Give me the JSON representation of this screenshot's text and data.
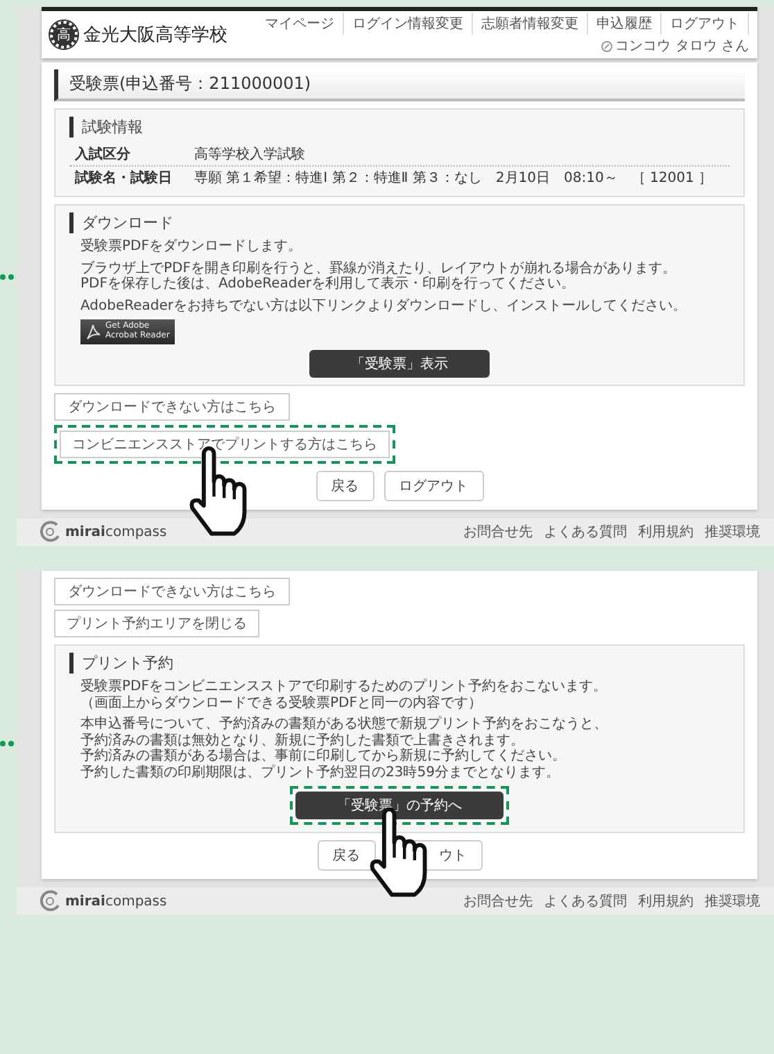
{
  "screens": [
    {
      "header": {
        "emblem": "高",
        "school": "金光大阪高等学校",
        "nav": [
          "マイページ",
          "ログイン情報変更",
          "志願者情報変更",
          "申込履歴",
          "ログアウト"
        ],
        "user": "コンコウ タロウ さん"
      },
      "page_title": "受験票(申込番号：211000001)",
      "blocks": [
        {
          "kind": "info",
          "heading": "試験情報",
          "rows": [
            {
              "label": "入試区分",
              "value": "高等学校入学試験"
            },
            {
              "label": "試験名・試験日",
              "value": "専願 第１希望：特進Ⅰ 第２：特進Ⅱ 第３：なし　2月10日　08:10～　［ 12001 ］"
            }
          ]
        },
        {
          "kind": "download",
          "heading": "ダウンロード",
          "paragraphs": [
            [
              "受験票PDFをダウンロードします。"
            ],
            [
              "ブラウザ上でPDFを開き印刷を行うと、罫線が消えたり、レイアウトが崩れる場合があります。",
              "PDFを保存した後は、AdobeReaderを利用して表示・印刷を行ってください。"
            ],
            [
              "AdobeReaderをお持ちでない方は以下リンクよりダウンロードし、インストールしてください。"
            ]
          ],
          "badge": [
            "Get Adobe",
            "Acrobat Reader"
          ],
          "button": {
            "label": "「受験票」表示",
            "highlighted": false
          }
        },
        {
          "kind": "links",
          "links": [
            {
              "label": "ダウンロードできない方はこちら",
              "highlighted": false
            },
            {
              "label": "コンビニエンスストアでプリントする方はこちら",
              "highlighted": true
            }
          ]
        },
        {
          "kind": "actions",
          "actions": [
            {
              "label": "戻る"
            },
            {
              "label": "ログアウト"
            }
          ]
        }
      ],
      "footer": {
        "logo": "**mirai**compass",
        "links": [
          "お問合せ先",
          "よくある質問",
          "利用規約",
          "推奨環境"
        ]
      }
    },
    {
      "blocks": [
        {
          "kind": "links",
          "links": [
            {
              "label": "ダウンロードできない方はこちら",
              "highlighted": false
            },
            {
              "label": "プリント予約エリアを閉じる",
              "highlighted": false
            }
          ]
        },
        {
          "kind": "print",
          "heading": "プリント予約",
          "paragraphs": [
            [
              "受験票PDFをコンビニエンスストアで印刷するためのプリント予約をおこないます。",
              "（画面上からダウンロードできる受験票PDFと同一の内容です）"
            ],
            [
              "本申込番号について、予約済みの書類がある状態で新規プリント予約をおこなうと、",
              "予約済みの書類は無効となり、新規に予約した書類で上書きされます。",
              "予約済みの書類がある場合は、事前に印刷してから新規に予約してください。",
              "予約した書類の印刷期限は、プリント予約翌日の23時59分までとなります。"
            ]
          ],
          "button": {
            "label": "「受験票」の予約へ",
            "highlighted": true
          }
        },
        {
          "kind": "actions",
          "actions": [
            {
              "label": "戻る",
              "covered": false
            },
            {
              "label": "ウト",
              "covered": true
            }
          ]
        }
      ],
      "footer": {
        "logo": "**mirai**compass",
        "links": [
          "お問合せ先",
          "よくある質問",
          "利用規約",
          "推奨環境"
        ]
      }
    }
  ]
}
